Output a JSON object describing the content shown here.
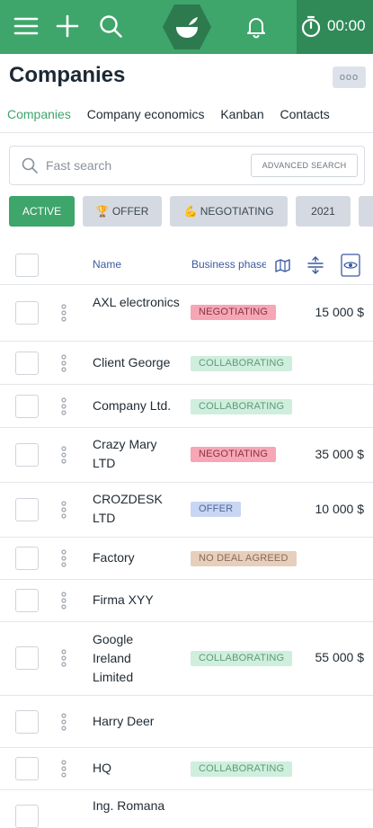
{
  "topbar": {
    "timer": "00:00",
    "bg_color": "#3ea56b"
  },
  "page": {
    "title": "Companies",
    "more_label": "ooo"
  },
  "tabs": [
    {
      "label": "Companies",
      "active": true
    },
    {
      "label": "Company economics",
      "active": false
    },
    {
      "label": "Kanban",
      "active": false
    },
    {
      "label": "Contacts",
      "active": false
    }
  ],
  "search": {
    "placeholder": "Fast search",
    "advanced_label": "ADVANCED SEARCH"
  },
  "filters": [
    {
      "label": "ACTIVE",
      "icon": "",
      "active": true
    },
    {
      "label": "OFFER",
      "icon": "🏆",
      "active": false
    },
    {
      "label": "NEGOTIATING",
      "icon": "💪",
      "active": false
    },
    {
      "label": "2021",
      "icon": "",
      "active": false
    },
    {
      "label": "",
      "icon": "",
      "active": false
    }
  ],
  "columns": {
    "name": "Name",
    "phase": "Business phase"
  },
  "rows": [
    {
      "name": "AXL electronics",
      "phase": "NEGOTIATING",
      "phase_type": "neg",
      "amount": "15 000 $"
    },
    {
      "name": "Client George",
      "phase": "COLLABORATING",
      "phase_type": "col",
      "amount": ""
    },
    {
      "name": "Company Ltd.",
      "phase": "COLLABORATING",
      "phase_type": "col",
      "amount": ""
    },
    {
      "name": "Crazy Mary LTD",
      "phase": "NEGOTIATING",
      "phase_type": "neg",
      "amount": "35 000 $"
    },
    {
      "name": "CROZDESK LTD",
      "phase": "OFFER",
      "phase_type": "off",
      "amount": "10 000 $"
    },
    {
      "name": "Factory",
      "phase": "NO DEAL AGREED",
      "phase_type": "nd",
      "amount": ""
    },
    {
      "name": "Firma XYY",
      "phase": "",
      "phase_type": "",
      "amount": ""
    },
    {
      "name": "Google Ireland Limited",
      "phase": "COLLABORATING",
      "phase_type": "col",
      "amount": "55 000 $"
    },
    {
      "name": "Harry Deer",
      "phase": "",
      "phase_type": "",
      "amount": ""
    },
    {
      "name": "HQ",
      "phase": "COLLABORATING",
      "phase_type": "col",
      "amount": ""
    },
    {
      "name": "Ing. Romana",
      "phase": "",
      "phase_type": "",
      "amount": ""
    }
  ]
}
